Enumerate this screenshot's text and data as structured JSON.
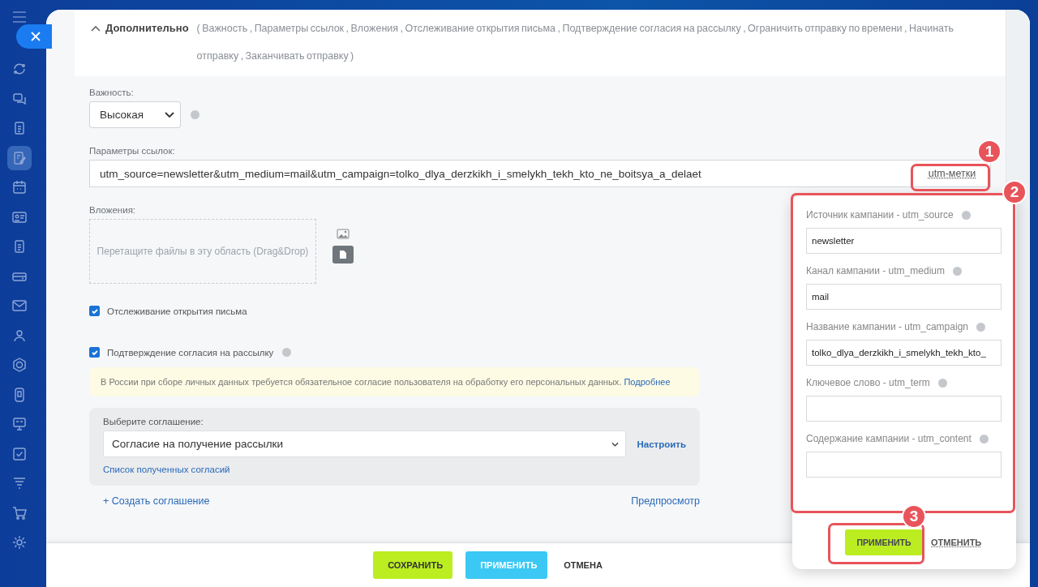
{
  "sidebar": {
    "items": [
      {
        "selected": false
      },
      {
        "selected": false
      },
      {
        "selected": false
      },
      {
        "selected": true
      },
      {
        "selected": false
      },
      {
        "selected": false
      },
      {
        "selected": false
      },
      {
        "selected": false
      },
      {
        "selected": false
      },
      {
        "selected": false
      },
      {
        "selected": false
      },
      {
        "selected": false
      },
      {
        "selected": false
      },
      {
        "selected": false
      },
      {
        "selected": false
      },
      {
        "selected": false
      },
      {
        "selected": false
      }
    ]
  },
  "advanced": {
    "title": "Дополнительно",
    "expanded": true,
    "summary": "( Важность ,  Параметры ссылок ,  Вложения ,  Отслеживание открытия письма ,  Подтверждение согласия на рассылку ,  Ограничить отправку по времени ,  Начинать отправку ,  Заканчивать отправку  )"
  },
  "importance": {
    "label": "Важность:",
    "value": "Высокая"
  },
  "link_params": {
    "label": "Параметры ссылок:",
    "value": "utm_source=newsletter&utm_medium=mail&utm_campaign=tolko_dlya_derzkikh_i_smelykh_tekh_kto_ne_boitsya_a_delaet",
    "utm_button": "utm-метки"
  },
  "attachments": {
    "label": "Вложения:",
    "dropzone": "Перетащите файлы в эту область (Drag&Drop)"
  },
  "checkboxes": [
    {
      "label": "Отслеживание открытия письма",
      "checked": true,
      "help": false
    },
    {
      "label": "Подтверждение согласия на рассылку",
      "checked": true,
      "help": true
    }
  ],
  "notice": {
    "text": "В России при сборе личных данных требуется обязательное согласие пользователя на обработку его персональных данных.",
    "link": "Подробнее"
  },
  "agreement": {
    "label": "Выберите соглашение:",
    "value": "Согласие на получение рассылки",
    "configure": "Настроить",
    "list_link": "Список полученных согласий"
  },
  "create_link": "+ Создать соглашение",
  "preview_link": "Предпросмотр",
  "footer_buttons": [
    {
      "label": "СОХРАНИТЬ",
      "kind": "save"
    },
    {
      "label": "ПРИМЕНИТЬ",
      "kind": "apply"
    },
    {
      "label": "ОТМЕНА",
      "kind": "cancel"
    }
  ],
  "utm_popup": {
    "fields": [
      {
        "label": "Источник кампании - utm_source",
        "value": "newsletter"
      },
      {
        "label": "Канал кампании - utm_medium",
        "value": "mail"
      },
      {
        "label": "Название кампании - utm_campaign",
        "value": "tolko_dlya_derzkikh_i_smelykh_tekh_kto_"
      },
      {
        "label": "Ключевое слово - utm_term"
      },
      {
        "label": "Содержание кампании - utm_content"
      }
    ],
    "apply": "ПРИМЕНИТЬ",
    "cancel": "ОТМЕНИТЬ"
  },
  "annotations": [
    "1",
    "2",
    "3"
  ]
}
